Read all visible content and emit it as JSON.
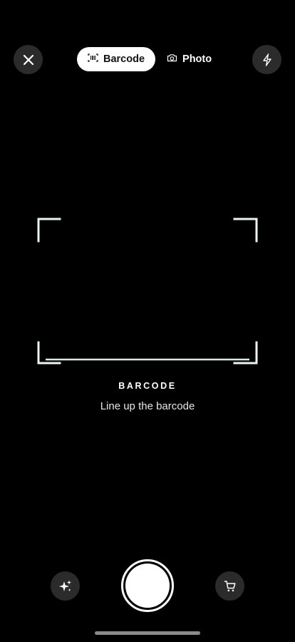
{
  "header": {
    "close_icon": "close-icon",
    "flash_icon": "flash-icon",
    "modes": [
      {
        "label": "Barcode",
        "icon": "barcode-icon",
        "selected": true
      },
      {
        "label": "Photo",
        "icon": "camera-icon",
        "selected": false
      }
    ]
  },
  "scanner": {
    "title": "BARCODE",
    "instruction": "Line up the barcode",
    "frame_color": "#e8f5f2"
  },
  "bottom_bar": {
    "left_icon": "sparkles-icon",
    "center": "shutter-button",
    "right_icon": "shopping-cart-icon"
  },
  "colors": {
    "background": "#000000",
    "button_bg": "#2b2b2b",
    "active_tab_bg": "#ffffff"
  }
}
